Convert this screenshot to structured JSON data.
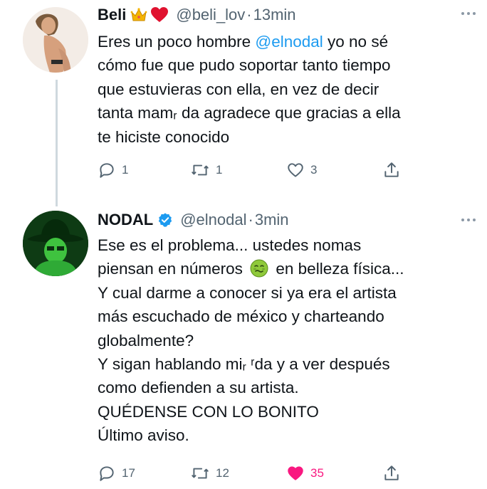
{
  "tweets": [
    {
      "name": "Beli",
      "handle": "@beli_lov",
      "separator": "·",
      "time": "13min",
      "badges": [
        "crown-emoji",
        "red-heart-emoji"
      ],
      "text_lines": [
        [
          {
            "t": "Eres un poco hombre "
          },
          {
            "t": "@elnodal",
            "mention": true
          },
          {
            "t": " yo no sé"
          }
        ],
        [
          {
            "t": "cómo fue que pudo soportar tanto tiempo"
          }
        ],
        [
          {
            "t": "que estuvieras con ella, en vez de decir"
          }
        ],
        [
          {
            "t": "tanta mam⁠ᵣ da agradece que gracias a ella"
          }
        ],
        [
          {
            "t": "te hiciste conocido"
          }
        ]
      ],
      "actions": {
        "replies": "1",
        "retweets": "1",
        "likes": "3",
        "liked": false
      }
    },
    {
      "name": "NODAL",
      "handle": "@elnodal",
      "separator": "·",
      "time": "3min",
      "verified": true,
      "text_lines": [
        [
          {
            "t": "Ese es el problema... ustedes nomas"
          }
        ],
        [
          {
            "t": "piensan en números "
          },
          {
            "emoji": "nauseated-face"
          },
          {
            "t": " en belleza física..."
          }
        ],
        [
          {
            "t": "Y cual darme a conocer si ya era el artista"
          }
        ],
        [
          {
            "t": "más escuchado de méxico y charteando"
          }
        ],
        [
          {
            "t": "globalmente?"
          }
        ],
        [
          {
            "t": "Y sigan hablando mi⁠ᵣ ʳda y a ver después"
          }
        ],
        [
          {
            "t": "como defienden a su artista."
          }
        ],
        [
          {
            "t": "QUÉDENSE CON LO BONITO"
          }
        ],
        [
          {
            "t": "Último aviso."
          }
        ]
      ],
      "actions": {
        "replies": "17",
        "retweets": "12",
        "likes": "35",
        "liked": true
      }
    }
  ],
  "colors": {
    "link": "#1d9bf0",
    "secondary": "#536471",
    "like": "#f91880",
    "verified": "#1d9bf0"
  },
  "icons": [
    "more-icon",
    "reply-icon",
    "retweet-icon",
    "like-icon",
    "share-icon",
    "verified-icon"
  ]
}
